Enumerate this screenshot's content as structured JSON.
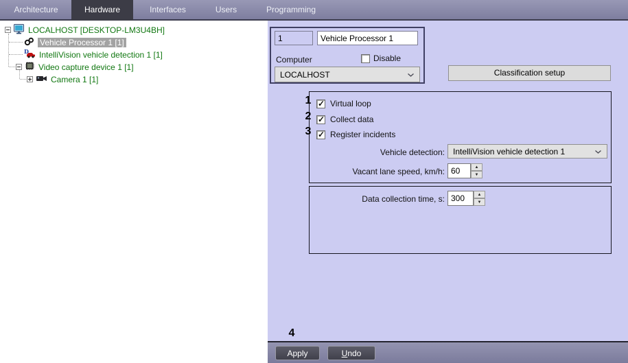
{
  "nav": {
    "tabs": [
      "Architecture",
      "Hardware",
      "Interfaces",
      "Users",
      "Programming"
    ],
    "active_tab": "Hardware"
  },
  "tree": {
    "items": [
      {
        "label": "LOCALHOST [DESKTOP-LM3U4BH]",
        "icon": "monitor",
        "expander": "minus",
        "selected": false
      },
      {
        "label": "Vehicle Processor 1 [1]",
        "icon": "vehicle-processor",
        "expander": "none",
        "selected": true
      },
      {
        "label": "IntelliVision vehicle detection 1 [1]",
        "icon": "vehicle-detection",
        "expander": "none",
        "selected": false
      },
      {
        "label": "Video capture device 1 [1]",
        "icon": "capture-chip",
        "expander": "minus",
        "selected": false
      },
      {
        "label": "Camera 1 [1]",
        "icon": "camera",
        "expander": "plus",
        "selected": false
      }
    ]
  },
  "settings_panel": {
    "id_value": "1",
    "name_value": "Vehicle Processor 1",
    "computer_label": "Computer",
    "disable_label": "Disable",
    "disable_checked": false,
    "computer_value": "LOCALHOST",
    "classification_button_label": "Classification setup",
    "options": {
      "virtual_loop": {
        "label": "Virtual loop",
        "checked": true,
        "annotation": "1"
      },
      "collect_data": {
        "label": "Collect data",
        "checked": true,
        "annotation": "2"
      },
      "register_incidents": {
        "label": "Register incidents",
        "checked": true,
        "annotation": "3"
      }
    },
    "vehicle_detection": {
      "label": "Vehicle detection:",
      "value": "IntelliVision vehicle detection 1"
    },
    "vacant_lane_speed": {
      "label": "Vacant lane speed, km/h:",
      "value": "60"
    },
    "data_collection_time": {
      "label": "Data collection time, s:",
      "value": "300"
    }
  },
  "footer": {
    "apply_label": "Apply",
    "undo_label": "Undo",
    "annotation": "4"
  },
  "colors": {
    "panel_lavender": "#ccccf2",
    "nav_gradient_top": "#9898b5",
    "nav_gradient_bottom": "#7c7c9e",
    "active_tab_bg": "#3c3c46",
    "tree_text_green": "#117711",
    "selected_item_bg": "#a3a3a3",
    "dark_button_bg": "#4a4a54"
  }
}
